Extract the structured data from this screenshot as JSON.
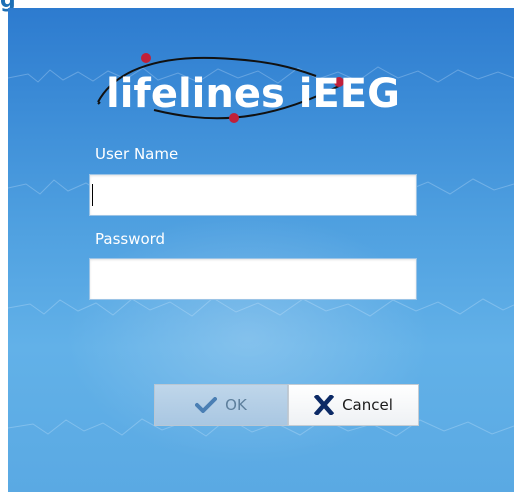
{
  "window": {
    "partial_title": "g"
  },
  "brand": {
    "logo_text": "lifelines iEEG",
    "colors": {
      "logo_text": "#ffffff",
      "logo_accent": "#c0203a",
      "background_top": "#2d7bcf",
      "background_bottom": "#5aa9e3"
    }
  },
  "form": {
    "username_label": "User Name",
    "username_value": "",
    "password_label": "Password",
    "password_value": ""
  },
  "buttons": {
    "ok_label": "OK",
    "ok_icon": "checkmark-icon",
    "cancel_label": "Cancel",
    "cancel_icon": "x-icon"
  }
}
